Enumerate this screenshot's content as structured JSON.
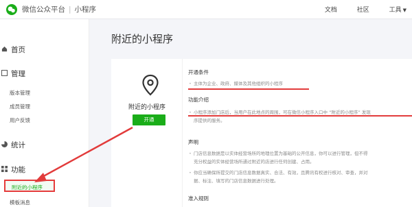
{
  "header": {
    "brand": "微信公众平台",
    "separator": "|",
    "product": "小程序",
    "links": [
      "文档",
      "社区",
      "工具"
    ]
  },
  "sidebar": {
    "groups": [
      {
        "icon": "home-icon",
        "label": "首页"
      },
      {
        "icon": "manage-icon",
        "label": "管理",
        "items": [
          "版本管理",
          "成员管理",
          "用户反馈"
        ]
      },
      {
        "icon": "stats-icon",
        "label": "统计"
      },
      {
        "icon": "feature-icon",
        "label": "功能",
        "items": [
          "附近的小程序",
          "模板消息"
        ]
      }
    ],
    "active_item": "附近的小程序"
  },
  "main": {
    "title": "附近的小程序",
    "card": {
      "icon": "location-pin-icon",
      "title": "附近的小程序",
      "button_label": "开通"
    },
    "sections": [
      {
        "title": "开通条件",
        "lines": [
          "主体为企业、政府、媒体及其他组织的小程序"
        ]
      },
      {
        "title": "功能介绍",
        "lines": [
          "小程序添加门店后，当用户在此地点的周围，可在微信小程序入口中 “附近的小程序” 发现",
          "序提供的服务。"
        ]
      },
      {
        "title": "声明",
        "lines": [
          "门店信息数据是以实体经营场所的地理位置为基础的公开信息，你可以进行管理，但不得",
          "充分权益的实体经营场所通过附近的店进行任何创建、占用。",
          "你应当确保所提交的门店信息数据真实、合法、有效，且腾讯有权进行核对、审查，并对",
          "据、标注、填写的门店信息数据进行处理。"
        ]
      },
      {
        "title": "准入规则",
        "lines": []
      }
    ]
  },
  "colors": {
    "accent_green": "#1aad19",
    "annotation_red": "#e23b3b"
  }
}
